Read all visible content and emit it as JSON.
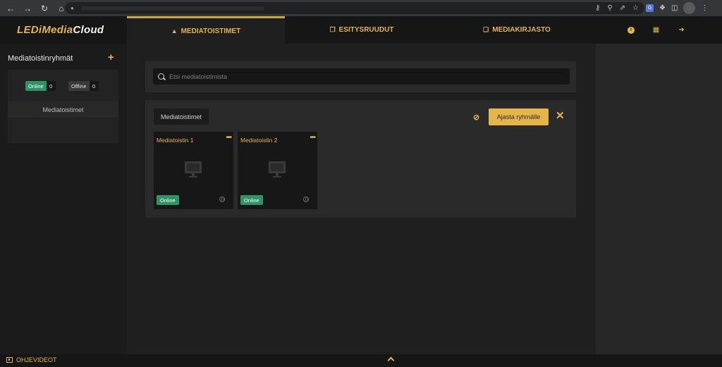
{
  "app": {
    "logo_part1": "LEDiMedia",
    "logo_part2": "Cloud"
  },
  "tabs": [
    {
      "label": "MEDIATOISTIMET",
      "icon": "device-icon",
      "active": true
    },
    {
      "label": "ESITYSRUUDUT",
      "icon": "copy-icon",
      "active": false
    },
    {
      "label": "MEDIAKIRJASTO",
      "icon": "library-icon",
      "active": false
    }
  ],
  "header_icons": [
    "info-icon",
    "grid-icon",
    "logout-icon"
  ],
  "sidebar": {
    "title": "Mediatoistinryhmät",
    "add_symbol": "+",
    "online_label": "Online",
    "online_count": "0",
    "offline_label": "Offline",
    "offline_count": "0",
    "group_label": "Mediatoistimet"
  },
  "search": {
    "placeholder": "Etsi mediatoistimista"
  },
  "group": {
    "name": "Mediatoistimet",
    "schedule_label": "Ajasta ryhmälle"
  },
  "players": [
    {
      "name": "Mediatoistin 1",
      "status": "Online",
      "menu": "•••"
    },
    {
      "name": "Mediatoistin 2",
      "status": "Online",
      "menu": "•••"
    }
  ],
  "footer": {
    "label": "OHJEVIDEOT"
  },
  "colors": {
    "accent": "#e5b54a",
    "online": "#2e9466",
    "header_bg": "#161616",
    "main_bg": "#1f1f1f"
  }
}
